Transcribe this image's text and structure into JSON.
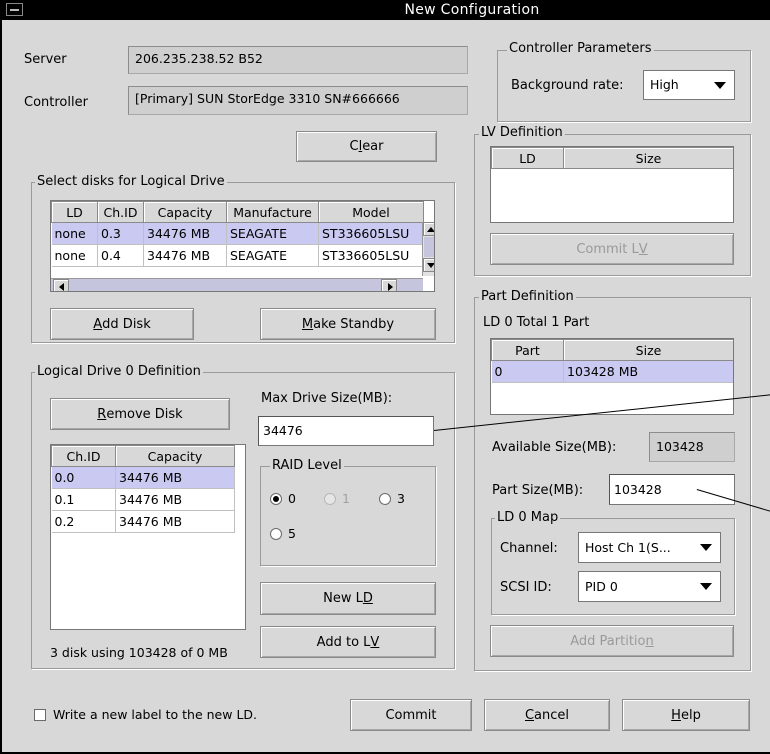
{
  "window": {
    "title": "New Configuration"
  },
  "server": {
    "label": "Server",
    "value": "206.235.238.52 B52"
  },
  "controller": {
    "label": "Controller",
    "value": "[Primary] SUN StorEdge 3310 SN#666666"
  },
  "clear_button": {
    "pre": "C",
    "u": "l",
    "post": "ear"
  },
  "select_disks": {
    "title": "Select disks for Logical Drive",
    "columns": [
      "LD",
      "Ch.ID",
      "Capacity",
      "Manufacture",
      "Model"
    ],
    "rows": [
      {
        "ld": "none",
        "chid": "0.3",
        "capacity": "34476 MB",
        "manufacture": "SEAGATE",
        "model": "ST336605LSU"
      },
      {
        "ld": "none",
        "chid": "0.4",
        "capacity": "34476 MB",
        "manufacture": "SEAGATE",
        "model": "ST336605LSU"
      }
    ],
    "add_disk": {
      "u": "A",
      "post": "dd Disk"
    },
    "make_standby": {
      "u": "M",
      "post": "ake Standby"
    }
  },
  "ld_definition": {
    "title": "Logical Drive 0  Definition",
    "remove_disk": {
      "u": "R",
      "post": "emove Disk"
    },
    "columns": [
      "Ch.ID",
      "Capacity"
    ],
    "rows": [
      {
        "chid": "0.0",
        "capacity": "34476 MB"
      },
      {
        "chid": "0.1",
        "capacity": "34476 MB"
      },
      {
        "chid": "0.2",
        "capacity": "34476 MB"
      }
    ],
    "summary": "3 disk using 103428 of 0 MB",
    "max_drive_size_label": "Max Drive Size(MB):",
    "max_drive_size_value": "34476",
    "raid_level_title": "RAID Level",
    "raid_options": [
      "0",
      "1",
      "3",
      "5"
    ],
    "raid_selected": "0",
    "new_ld": {
      "pre": "New L",
      "u": "D"
    },
    "add_to_lv": {
      "pre": "Add to L",
      "u": "V"
    }
  },
  "controller_params": {
    "title": "Controller Parameters",
    "bg_rate_label": "Background rate:",
    "bg_rate_value": "High"
  },
  "lv_definition": {
    "title": "LV Definition",
    "columns": [
      "LD",
      "Size"
    ],
    "commit_lv": {
      "pre": "Commit L",
      "u": "V"
    }
  },
  "part_definition": {
    "title": "Part Definition",
    "summary": "LD 0 Total 1 Part",
    "columns": [
      "Part",
      "Size"
    ],
    "rows": [
      {
        "part": "0",
        "size": "103428 MB"
      }
    ],
    "available_label": "Available Size(MB):",
    "available_value": "103428",
    "part_size_label": "Part Size(MB):",
    "part_size_value": "103428",
    "map_title": "LD 0 Map",
    "channel_label": "Channel:",
    "channel_value": "Host Ch 1(S...",
    "scsi_label": "SCSI ID:",
    "scsi_value": "PID 0",
    "add_partition": {
      "pre": "Add Partitio",
      "u": "n"
    }
  },
  "footer": {
    "checkbox_label": "Write a new label to the new LD.",
    "commit": "Commit",
    "cancel": {
      "u": "C",
      "post": "ancel"
    },
    "help": {
      "u": "H",
      "post": "elp"
    }
  },
  "colors": {
    "selection": "#c9c9f2",
    "window_bg": "#d8d8d8",
    "title_bar": "#000000"
  }
}
